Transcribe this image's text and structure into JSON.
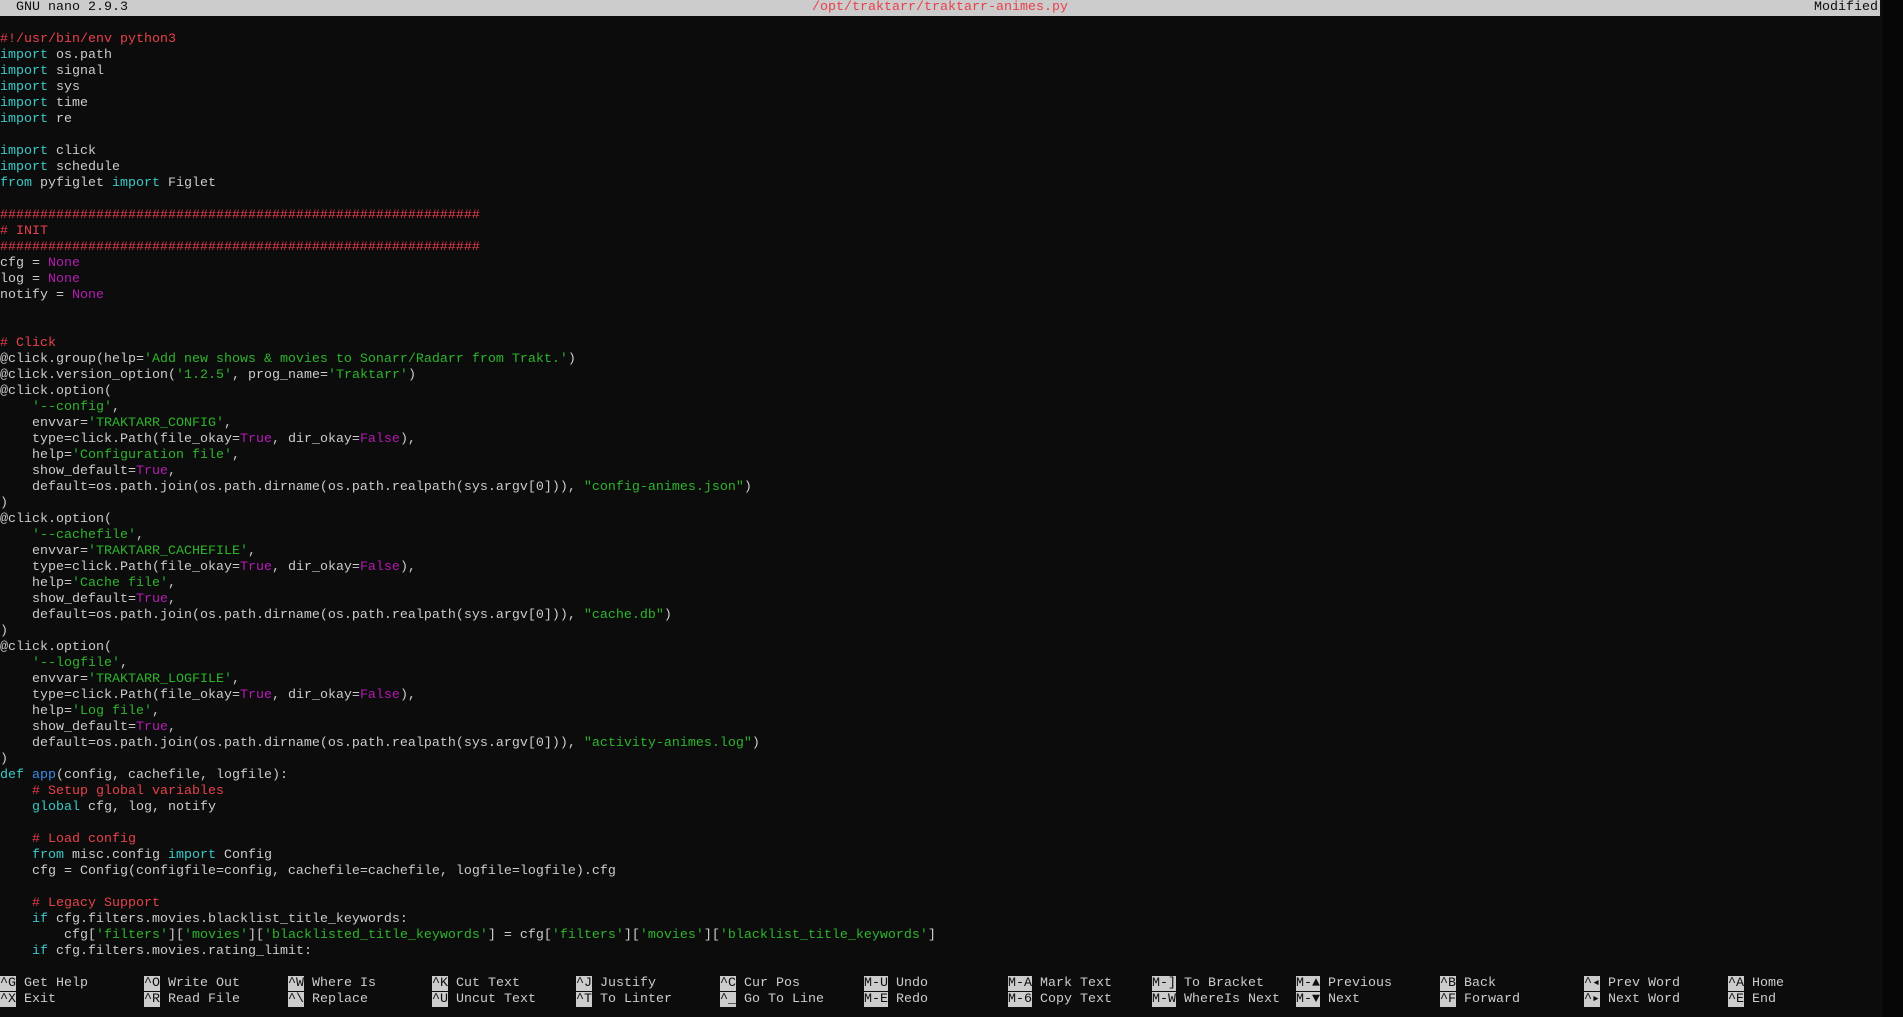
{
  "titlebar": {
    "app": "GNU nano 2.9.3",
    "file": "/opt/traktarr/traktarr-animes.py",
    "status": "Modified"
  },
  "colors": {
    "background": "#0c0c0c",
    "keyword": "#3ac8c8",
    "comment": "#e8404c",
    "string": "#2db52d",
    "constant": "#b51ab5",
    "function": "#3b8eea",
    "text": "#cccccc",
    "bar": "#cccccc"
  },
  "code": [
    [
      [
        "c",
        "#!/usr/bin/env python3"
      ]
    ],
    [
      [
        "k",
        "import"
      ],
      [
        "p",
        " os.path"
      ]
    ],
    [
      [
        "k",
        "import"
      ],
      [
        "p",
        " signal"
      ]
    ],
    [
      [
        "k",
        "import"
      ],
      [
        "p",
        " sys"
      ]
    ],
    [
      [
        "k",
        "import"
      ],
      [
        "p",
        " time"
      ]
    ],
    [
      [
        "k",
        "import"
      ],
      [
        "p",
        " re"
      ]
    ],
    [],
    [
      [
        "k",
        "import"
      ],
      [
        "p",
        " click"
      ]
    ],
    [
      [
        "k",
        "import"
      ],
      [
        "p",
        " schedule"
      ]
    ],
    [
      [
        "k",
        "from"
      ],
      [
        "p",
        " pyfiglet "
      ],
      [
        "k",
        "import"
      ],
      [
        "p",
        " Figlet"
      ]
    ],
    [],
    [
      [
        "c",
        "############################################################"
      ]
    ],
    [
      [
        "c",
        "# INIT"
      ]
    ],
    [
      [
        "c",
        "############################################################"
      ]
    ],
    [
      [
        "p",
        "cfg = "
      ],
      [
        "n",
        "None"
      ]
    ],
    [
      [
        "p",
        "log = "
      ],
      [
        "n",
        "None"
      ]
    ],
    [
      [
        "p",
        "notify = "
      ],
      [
        "n",
        "None"
      ]
    ],
    [],
    [],
    [
      [
        "c",
        "# Click"
      ]
    ],
    [
      [
        "p",
        "@click.group(help="
      ],
      [
        "s",
        "'Add new shows & movies to Sonarr/Radarr from Trakt.'"
      ],
      [
        "p",
        ")"
      ]
    ],
    [
      [
        "p",
        "@click.version_option("
      ],
      [
        "s",
        "'1.2.5'"
      ],
      [
        "p",
        ", prog_name="
      ],
      [
        "s",
        "'Traktarr'"
      ],
      [
        "p",
        ")"
      ]
    ],
    [
      [
        "p",
        "@click.option("
      ]
    ],
    [
      [
        "p",
        "    "
      ],
      [
        "s",
        "'--config'"
      ],
      [
        "p",
        ","
      ]
    ],
    [
      [
        "p",
        "    envvar="
      ],
      [
        "s",
        "'TRAKTARR_CONFIG'"
      ],
      [
        "p",
        ","
      ]
    ],
    [
      [
        "p",
        "    type=click.Path(file_okay="
      ],
      [
        "n",
        "True"
      ],
      [
        "p",
        ", dir_okay="
      ],
      [
        "n",
        "False"
      ],
      [
        "p",
        "),"
      ]
    ],
    [
      [
        "p",
        "    help="
      ],
      [
        "s",
        "'Configuration file'"
      ],
      [
        "p",
        ","
      ]
    ],
    [
      [
        "p",
        "    show_default="
      ],
      [
        "n",
        "True"
      ],
      [
        "p",
        ","
      ]
    ],
    [
      [
        "p",
        "    default=os.path.join(os.path.dirname(os.path.realpath(sys.argv[0])), "
      ],
      [
        "s",
        "\"config-animes.json\""
      ],
      [
        "p",
        ")"
      ]
    ],
    [
      [
        "p",
        ")"
      ]
    ],
    [
      [
        "p",
        "@click.option("
      ]
    ],
    [
      [
        "p",
        "    "
      ],
      [
        "s",
        "'--cachefile'"
      ],
      [
        "p",
        ","
      ]
    ],
    [
      [
        "p",
        "    envvar="
      ],
      [
        "s",
        "'TRAKTARR_CACHEFILE'"
      ],
      [
        "p",
        ","
      ]
    ],
    [
      [
        "p",
        "    type=click.Path(file_okay="
      ],
      [
        "n",
        "True"
      ],
      [
        "p",
        ", dir_okay="
      ],
      [
        "n",
        "False"
      ],
      [
        "p",
        "),"
      ]
    ],
    [
      [
        "p",
        "    help="
      ],
      [
        "s",
        "'Cache file'"
      ],
      [
        "p",
        ","
      ]
    ],
    [
      [
        "p",
        "    show_default="
      ],
      [
        "n",
        "True"
      ],
      [
        "p",
        ","
      ]
    ],
    [
      [
        "p",
        "    default=os.path.join(os.path.dirname(os.path.realpath(sys.argv[0])), "
      ],
      [
        "s",
        "\"cache.db\""
      ],
      [
        "p",
        ")"
      ]
    ],
    [
      [
        "p",
        ")"
      ]
    ],
    [
      [
        "p",
        "@click.option("
      ]
    ],
    [
      [
        "p",
        "    "
      ],
      [
        "s",
        "'--logfile'"
      ],
      [
        "p",
        ","
      ]
    ],
    [
      [
        "p",
        "    envvar="
      ],
      [
        "s",
        "'TRAKTARR_LOGFILE'"
      ],
      [
        "p",
        ","
      ]
    ],
    [
      [
        "p",
        "    type=click.Path(file_okay="
      ],
      [
        "n",
        "True"
      ],
      [
        "p",
        ", dir_okay="
      ],
      [
        "n",
        "False"
      ],
      [
        "p",
        "),"
      ]
    ],
    [
      [
        "p",
        "    help="
      ],
      [
        "s",
        "'Log file'"
      ],
      [
        "p",
        ","
      ]
    ],
    [
      [
        "p",
        "    show_default="
      ],
      [
        "n",
        "True"
      ],
      [
        "p",
        ","
      ]
    ],
    [
      [
        "p",
        "    default=os.path.join(os.path.dirname(os.path.realpath(sys.argv[0])), "
      ],
      [
        "s",
        "\"activity-animes.log\""
      ],
      [
        "p",
        ")"
      ]
    ],
    [
      [
        "p",
        ")"
      ]
    ],
    [
      [
        "k",
        "def"
      ],
      [
        "p",
        " "
      ],
      [
        "f",
        "app"
      ],
      [
        "p",
        "(config, cachefile, logfile):"
      ]
    ],
    [
      [
        "p",
        "    "
      ],
      [
        "c",
        "# Setup global variables"
      ]
    ],
    [
      [
        "p",
        "    "
      ],
      [
        "k",
        "global"
      ],
      [
        "p",
        " cfg, log, notify"
      ]
    ],
    [],
    [
      [
        "p",
        "    "
      ],
      [
        "c",
        "# Load config"
      ]
    ],
    [
      [
        "p",
        "    "
      ],
      [
        "k",
        "from"
      ],
      [
        "p",
        " misc.config "
      ],
      [
        "k",
        "import"
      ],
      [
        "p",
        " Config"
      ]
    ],
    [
      [
        "p",
        "    cfg = Config(configfile=config, cachefile=cachefile, logfile=logfile).cfg"
      ]
    ],
    [],
    [
      [
        "p",
        "    "
      ],
      [
        "c",
        "# Legacy Support"
      ]
    ],
    [
      [
        "p",
        "    "
      ],
      [
        "k",
        "if"
      ],
      [
        "p",
        " cfg.filters.movies.blacklist_title_keywords:"
      ]
    ],
    [
      [
        "p",
        "        cfg["
      ],
      [
        "s",
        "'filters'"
      ],
      [
        "p",
        "]["
      ],
      [
        "s",
        "'movies'"
      ],
      [
        "p",
        "]["
      ],
      [
        "s",
        "'blacklisted_title_keywords'"
      ],
      [
        "p",
        "] = cfg["
      ],
      [
        "s",
        "'filters'"
      ],
      [
        "p",
        "]["
      ],
      [
        "s",
        "'movies'"
      ],
      [
        "p",
        "]["
      ],
      [
        "s",
        "'blacklist_title_keywords'"
      ],
      [
        "p",
        "]"
      ]
    ],
    [
      [
        "p",
        "    "
      ],
      [
        "k",
        "if"
      ],
      [
        "p",
        " cfg.filters.movies.rating_limit:"
      ]
    ]
  ],
  "shortcuts": [
    [
      {
        "key": "^G",
        "label": "Get Help"
      },
      {
        "key": "^X",
        "label": "Exit"
      }
    ],
    [
      {
        "key": "^O",
        "label": "Write Out"
      },
      {
        "key": "^R",
        "label": "Read File"
      }
    ],
    [
      {
        "key": "^W",
        "label": "Where Is"
      },
      {
        "key": "^\\",
        "label": "Replace"
      }
    ],
    [
      {
        "key": "^K",
        "label": "Cut Text"
      },
      {
        "key": "^U",
        "label": "Uncut Text"
      }
    ],
    [
      {
        "key": "^J",
        "label": "Justify"
      },
      {
        "key": "^T",
        "label": "To Linter"
      }
    ],
    [
      {
        "key": "^C",
        "label": "Cur Pos"
      },
      {
        "key": "^_",
        "label": "Go To Line"
      }
    ],
    [
      {
        "key": "M-U",
        "label": "Undo"
      },
      {
        "key": "M-E",
        "label": "Redo"
      }
    ],
    [
      {
        "key": "M-A",
        "label": "Mark Text"
      },
      {
        "key": "M-6",
        "label": "Copy Text"
      }
    ],
    [
      {
        "key": "M-]",
        "label": "To Bracket"
      },
      {
        "key": "M-W",
        "label": "WhereIs Next"
      }
    ],
    [
      {
        "key": "M-▲",
        "label": "Previous"
      },
      {
        "key": "M-▼",
        "label": "Next"
      }
    ],
    [
      {
        "key": "^B",
        "label": "Back"
      },
      {
        "key": "^F",
        "label": "Forward"
      }
    ],
    [
      {
        "key": "^◂",
        "label": "Prev Word"
      },
      {
        "key": "^▸",
        "label": "Next Word"
      }
    ],
    [
      {
        "key": "^A",
        "label": "Home"
      },
      {
        "key": "^E",
        "label": "End"
      }
    ]
  ]
}
